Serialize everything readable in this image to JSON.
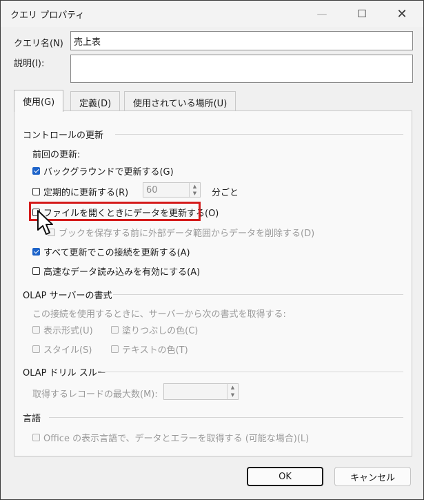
{
  "window": {
    "title": "クエリ プロパティ",
    "controls": {
      "minimize": "—",
      "maximize": "☐",
      "close": "✕"
    }
  },
  "fields": {
    "query_name_label": "クエリ名(N)",
    "query_name_value": "売上表",
    "description_label": "説明(I):",
    "description_value": ""
  },
  "tabs": [
    {
      "label": "使用(G)",
      "active": true
    },
    {
      "label": "定義(D)",
      "active": false
    },
    {
      "label": "使用されている場所(U)",
      "active": false
    }
  ],
  "refresh_control": {
    "title": "コントロールの更新",
    "last_refresh_label": "前回の更新:",
    "background_refresh": {
      "label": "バックグラウンドで更新する(G)",
      "checked": true
    },
    "periodic_refresh": {
      "label": "定期的に更新する(R)",
      "checked": false,
      "minutes": "60",
      "unit": "分ごと"
    },
    "refresh_on_open": {
      "label": "ファイルを開くときにデータを更新する(O)",
      "checked": false
    },
    "remove_external_data": {
      "label": "ブックを保存する前に外部データ範囲からデータを削除する(D)",
      "checked": false
    },
    "refresh_all": {
      "label": "すべて更新でこの接続を更新する(A)",
      "checked": true
    },
    "fast_data_load": {
      "label": "高速なデータ読み込みを有効にする(A)",
      "checked": false
    }
  },
  "olap_format": {
    "title": "OLAP サーバーの書式",
    "description": "この接続を使用するときに、サーバーから次の書式を取得する:",
    "number_format": "表示形式(U)",
    "fill_color": "塗りつぶしの色(C)",
    "font_style": "スタイル(S)",
    "text_color": "テキストの色(T)"
  },
  "olap_drill": {
    "title": "OLAP ドリル スルー",
    "max_records_label": "取得するレコードの最大数(M):",
    "max_records_value": ""
  },
  "language": {
    "title": "言語",
    "office_language": "Office の表示言語で、データとエラーを取得する (可能な場合)(L)"
  },
  "buttons": {
    "ok": "OK",
    "cancel": "キャンセル"
  }
}
